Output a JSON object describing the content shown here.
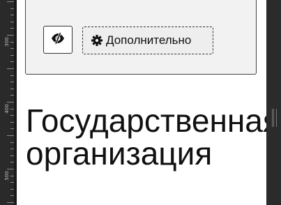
{
  "ruler": {
    "labels": [
      "300",
      "400",
      "500"
    ]
  },
  "panel": {
    "visibility_toggle_icon": "eye-slash-icon",
    "advanced_button": {
      "icon": "gear-icon",
      "label": "Дополнительно"
    }
  },
  "content": {
    "title": "Государственная организация"
  }
}
